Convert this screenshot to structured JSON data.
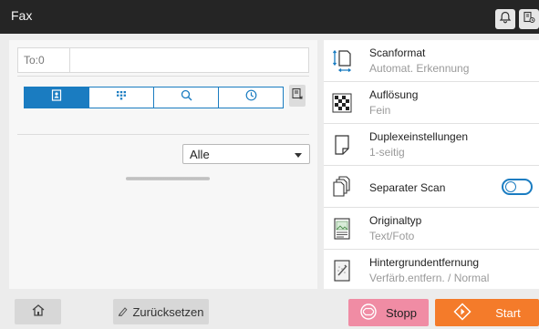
{
  "window": {
    "title": "Fax"
  },
  "header_icons": [
    "bell-icon",
    "device-status-icon"
  ],
  "destination": {
    "label": "To:0"
  },
  "address_tabs": [
    {
      "icon": "address-book-icon",
      "active": true
    },
    {
      "icon": "keypad-icon",
      "active": false
    },
    {
      "icon": "search-icon",
      "active": false
    },
    {
      "icon": "history-icon",
      "active": false
    }
  ],
  "filter": {
    "selected": "Alle"
  },
  "settings": [
    {
      "title": "Scanformat",
      "value": "Automat. Erkennung",
      "icon": "scan-size-icon"
    },
    {
      "title": "Auflösung",
      "value": "Fein",
      "icon": "resolution-icon"
    },
    {
      "title": "Duplexeinstellungen",
      "value": "1-seitig",
      "icon": "duplex-icon"
    },
    {
      "title": "Separater Scan",
      "value": "",
      "icon": "separate-scan-icon",
      "toggle": false
    },
    {
      "title": "Originaltyp",
      "value": "Text/Foto",
      "icon": "original-type-icon"
    },
    {
      "title": "Hintergrundentfernung",
      "value": "Verfärb.entfern.  /  Normal",
      "icon": "background-removal-icon"
    }
  ],
  "bottom_bar": {
    "reset_label": "Zurücksetzen",
    "stop_label": "Stopp",
    "start_label": "Start"
  },
  "colors": {
    "titlebar": "#252525",
    "accent": "#1a7cc1",
    "stop": "#f08ca4",
    "start": "#f47b2a"
  }
}
